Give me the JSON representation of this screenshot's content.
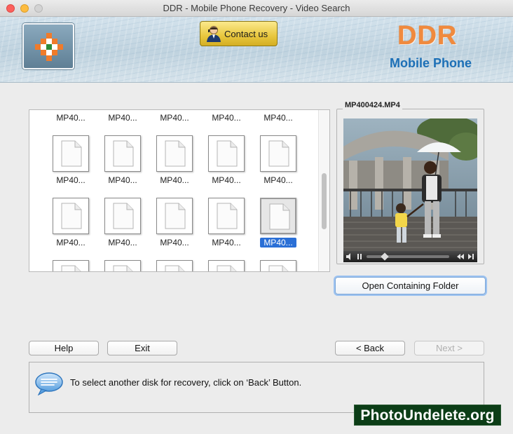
{
  "window": {
    "title": "DDR - Mobile Phone Recovery - Video Search"
  },
  "header": {
    "contact_label": "Contact us",
    "brand_name": "DDR",
    "brand_subtitle": "Mobile Phone"
  },
  "files": {
    "rows": [
      [
        "MP40...",
        "MP40...",
        "MP40...",
        "MP40...",
        "MP40..."
      ],
      [
        "MP40...",
        "MP40...",
        "MP40...",
        "MP40...",
        "MP40..."
      ],
      [
        "MP40...",
        "MP40...",
        "MP40...",
        "MP40...",
        "MP40..."
      ]
    ],
    "selected_row": 1,
    "selected_col": 4
  },
  "preview": {
    "filename": "MP400424.MP4",
    "open_folder_label": "Open Containing Folder"
  },
  "buttons": {
    "help": "Help",
    "exit": "Exit",
    "back": "< Back",
    "next": "Next >"
  },
  "message": {
    "text": "To select another disk for recovery, click on ‘Back’ Button."
  },
  "watermark": {
    "text": "PhotoUndelete.org"
  },
  "colors": {
    "accent": "#2a6fd6",
    "brand_orange": "#f08a3e",
    "brand_blue": "#1c6fb6",
    "contact_gold": "#e8c73e"
  }
}
